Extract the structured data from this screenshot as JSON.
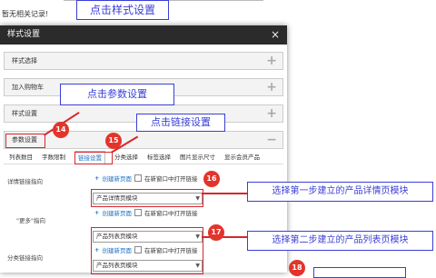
{
  "background": {
    "note": "暂无相关记录!"
  },
  "annotations": {
    "top": "点击样式设置",
    "params": "点击参数设置",
    "link": "点击链接设置",
    "step1": "选择第一步建立的产品详情页模块",
    "step2": "选择第二步建立的产品列表页模块",
    "n14": "14",
    "n15": "15",
    "n16": "16",
    "n17": "17",
    "n18": "18"
  },
  "dialog": {
    "title": "样式设置",
    "close": "×",
    "panels": [
      "样式选择",
      "加入购物车",
      "样式设置",
      "参数设置"
    ],
    "tabs": [
      "列表数目",
      "字数限制",
      "链接设置",
      "分类选择",
      "标签选择",
      "图片显示尺寸",
      "显示会员产品"
    ],
    "active_tab": 2,
    "rows": {
      "detail_label": "详情链接指向",
      "more_label": "\"更多\"指向",
      "category_label": "分类链接指向",
      "create": "创建新页面",
      "new_window": "在新窗口中打开链接",
      "detail_select": "产品详情页模块",
      "list_select": "产品列表页模块"
    }
  },
  "colors": {
    "annotation_red": "#d8262c",
    "annotation_blue": "#3a3fd6",
    "badge": "#e3342b",
    "link_blue": "#1a6fc1"
  }
}
